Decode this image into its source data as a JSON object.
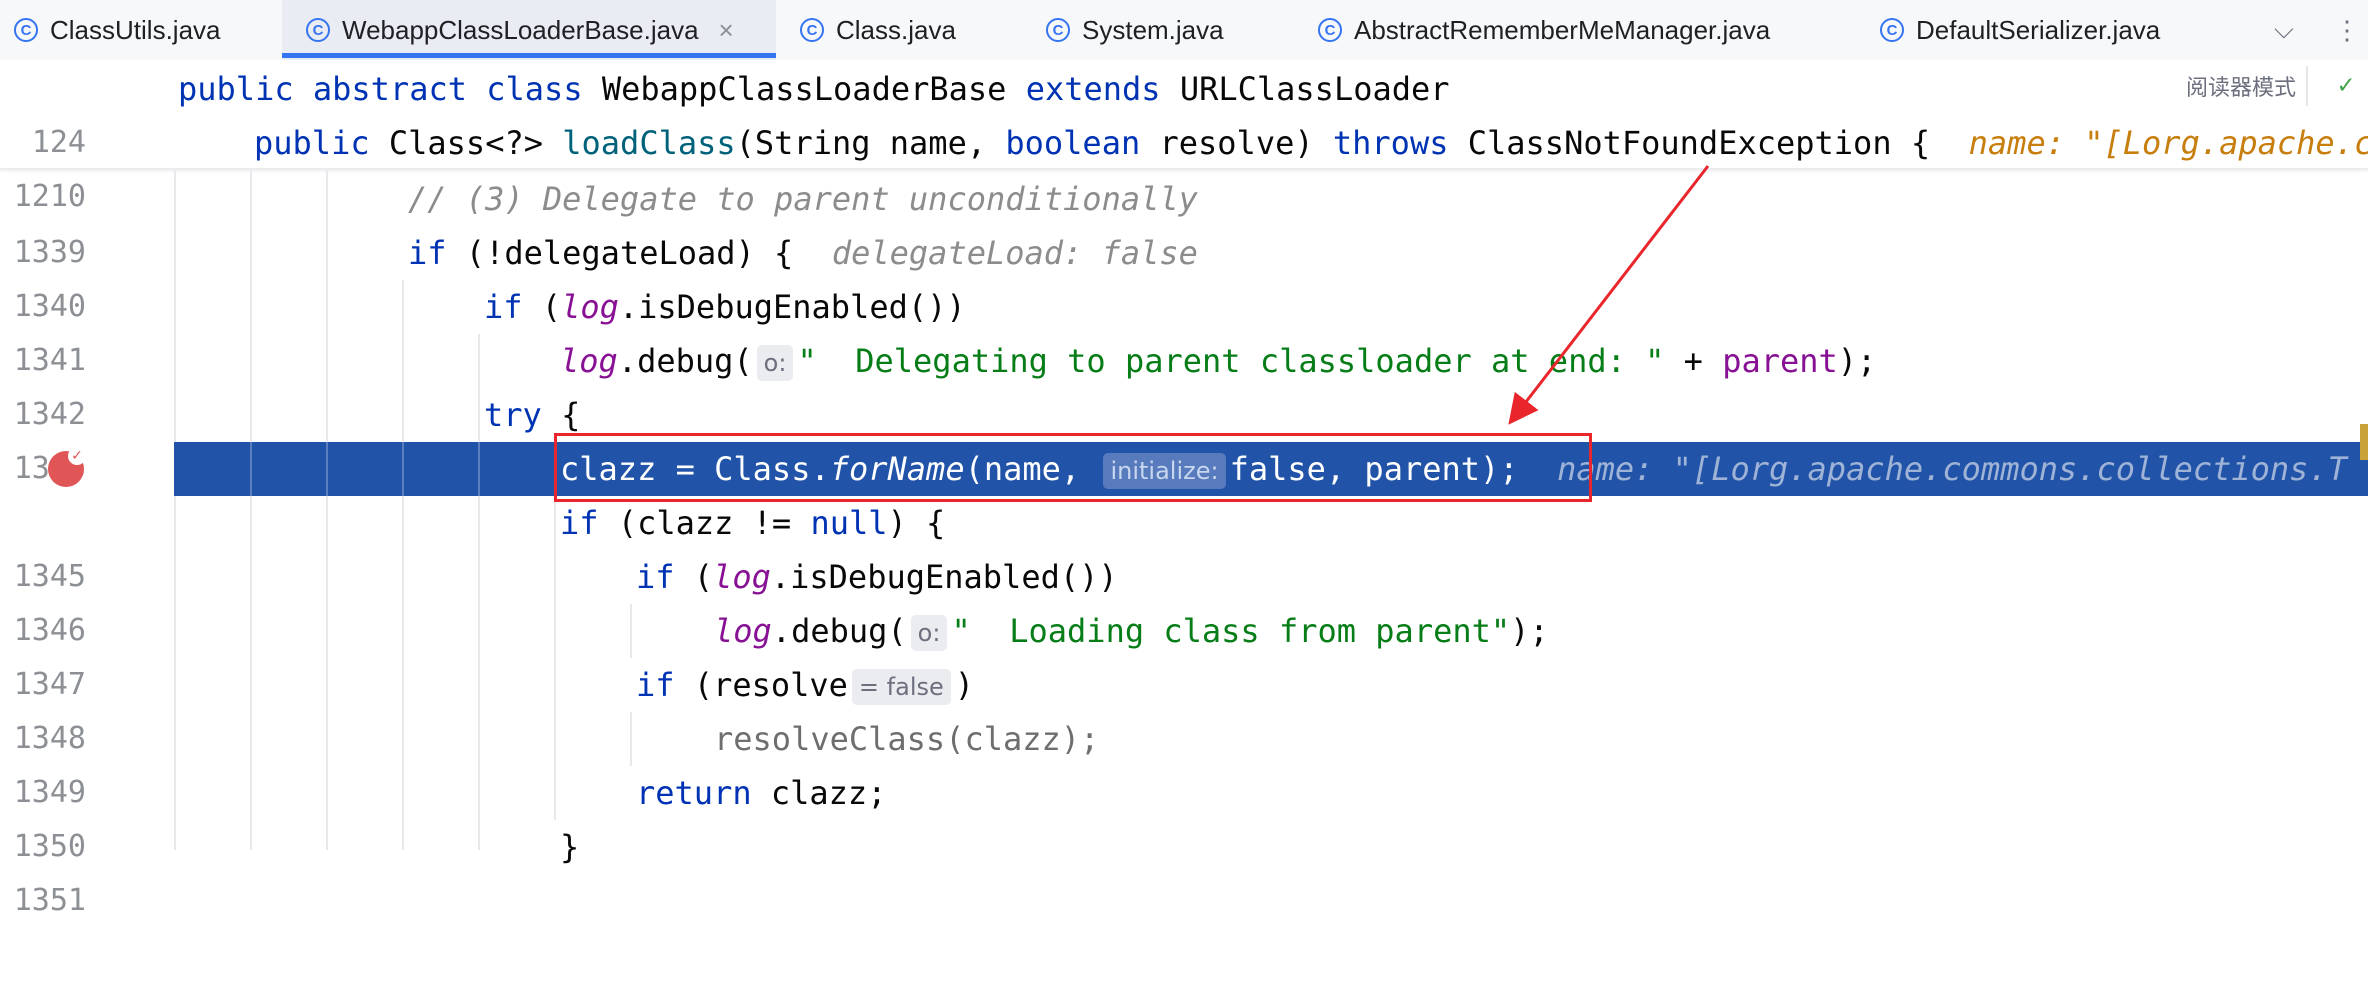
{
  "tabs": [
    {
      "name": "ClassUtils.java",
      "active": false
    },
    {
      "name": "WebappClassLoaderBase.java",
      "active": true
    },
    {
      "name": "Class.java",
      "active": false
    },
    {
      "name": "System.java",
      "active": false
    },
    {
      "name": "AbstractRememberMeManager.java",
      "active": false
    },
    {
      "name": "DefaultSerializer.java",
      "active": false
    }
  ],
  "tab_close_glyph": "×",
  "tab_icon_glyph": "C",
  "tab_actions": {
    "chevron": "⌵",
    "more": "⋮"
  },
  "reader_mode_label": "阅读器模式",
  "icons": {
    "tab_file": "class-icon",
    "reader_check": "check-icon",
    "breakpoint": "breakpoint-icon",
    "close": "close-icon"
  },
  "colors": {
    "keyword": "#0033b3",
    "string": "#067d17",
    "field": "#871094",
    "exec_line": "#2154a8",
    "breakpoint": "#e05555",
    "annotation": "#e8262b"
  },
  "sticky": {
    "line1": {
      "num": "124",
      "t1": "public abstract class ",
      "t2": "WebappClassLoaderBase ",
      "t3": "extends ",
      "t4": "URLClassLoader"
    },
    "line2": {
      "num": "1210",
      "t1": "public ",
      "t2": "Class<?> ",
      "t3": "loadClass",
      "t4": "(String name, ",
      "t5": "boolean ",
      "t6": "resolve) ",
      "t7": "throws ",
      "t8": "ClassNotFoundException {",
      "hint": "name: \"[Lorg.apache.c"
    }
  },
  "lines": {
    "l1339": {
      "num": "1339",
      "comment": "// (3) Delegate to parent unconditionally"
    },
    "l1340": {
      "num": "1340",
      "kw": "if ",
      "code": "(!delegateLoad) {",
      "hint": "delegateLoad: false"
    },
    "l1341": {
      "num": "1341",
      "kw": "if ",
      "code1": "(",
      "fld": "log",
      "code2": ".isDebugEnabled())"
    },
    "l1342": {
      "num": "1342",
      "fld": "log",
      "code1": ".debug(",
      "inlay": "o:",
      "str": "\"  Delegating to parent classloader at end: \"",
      "code2": " + ",
      "fld2": "parent",
      "code3": ");"
    },
    "l1343": {
      "num": "1343",
      "kw": "try ",
      "code": "{"
    },
    "l1344": {
      "num": "",
      "code1": "clazz = Class.",
      "it": "forName",
      "code2": "(name, ",
      "inlay": "initialize:",
      "code3": "false, parent);",
      "hint": "name: \"[Lorg.apache.commons.collections.T"
    },
    "l1345": {
      "num": "1345",
      "kw": "if ",
      "code1": "(clazz != ",
      "kw2": "null",
      "code2": ") {"
    },
    "l1346": {
      "num": "1346",
      "kw": "if ",
      "code1": "(",
      "fld": "log",
      "code2": ".isDebugEnabled())"
    },
    "l1347": {
      "num": "1347",
      "fld": "log",
      "code1": ".debug(",
      "inlay": "o:",
      "str": "\"  Loading class from parent\"",
      "code2": ");"
    },
    "l1348": {
      "num": "1348",
      "kw": "if ",
      "code1": "(resolve",
      "inlay": "= false",
      "code2": ")"
    },
    "l1349": {
      "num": "1349",
      "code": "resolveClass(clazz);"
    },
    "l1350": {
      "num": "1350",
      "kw": "return ",
      "code": "clazz;"
    },
    "l1351": {
      "num": "1351",
      "code": "}"
    }
  }
}
